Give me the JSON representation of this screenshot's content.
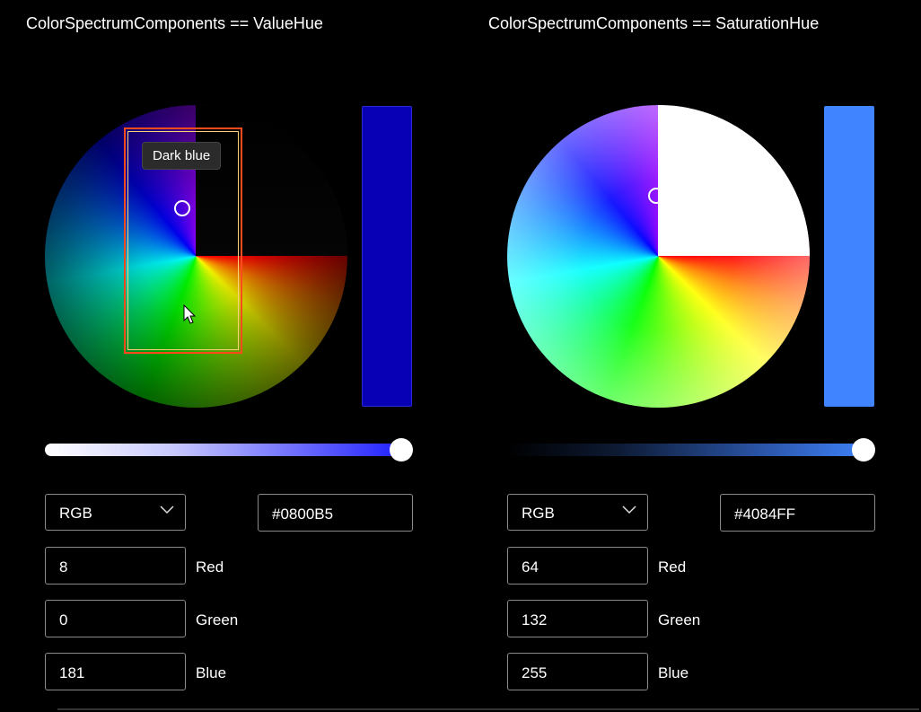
{
  "panels": [
    {
      "title": "ColorSpectrumComponents == ValueHue",
      "tooltip": "Dark blue",
      "color_mode": "RGB",
      "hex": "#0800B5",
      "channels": [
        {
          "value": "8",
          "label": "Red"
        },
        {
          "value": "0",
          "label": "Green"
        },
        {
          "value": "181",
          "label": "Blue"
        }
      ],
      "preview_color": "#0800B5",
      "slider_value_percent": 97
    },
    {
      "title": "ColorSpectrumComponents == SaturationHue",
      "color_mode": "RGB",
      "hex": "#4084FF",
      "channels": [
        {
          "value": "64",
          "label": "Red"
        },
        {
          "value": "132",
          "label": "Green"
        },
        {
          "value": "255",
          "label": "Blue"
        }
      ],
      "preview_color": "#4084FF",
      "slider_value_percent": 97
    }
  ],
  "icons": {
    "dropdown": "chevron-down-icon",
    "cursor": "mouse-pointer-icon",
    "selector": "selection-ring-icon"
  }
}
